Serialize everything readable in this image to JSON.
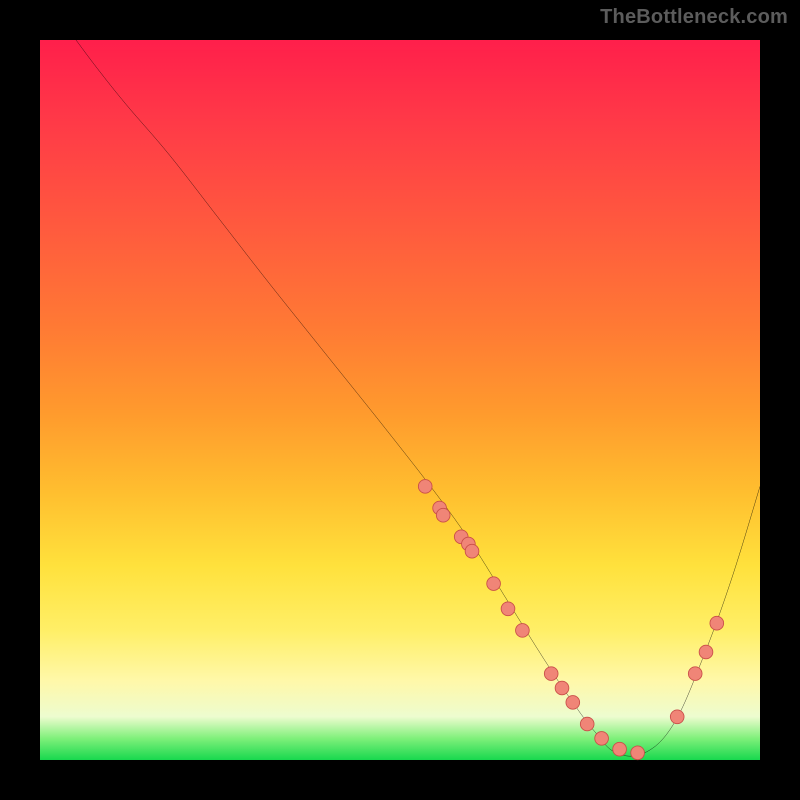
{
  "watermark": "TheBottleneck.com",
  "chart_data": {
    "type": "line",
    "title": "",
    "xlabel": "",
    "ylabel": "",
    "xlim": [
      0,
      100
    ],
    "ylim": [
      0,
      100
    ],
    "grid": false,
    "legend": false,
    "series": [
      {
        "name": "curve",
        "type": "line",
        "x": [
          5,
          8,
          12,
          18,
          25,
          32,
          40,
          48,
          55,
          60,
          65,
          70,
          74,
          77,
          80,
          84,
          88,
          92,
          96,
          100
        ],
        "y": [
          100,
          96,
          91,
          84,
          75,
          66,
          56,
          46,
          37,
          30,
          22,
          14,
          8,
          4,
          1,
          1,
          5,
          14,
          25,
          38
        ]
      },
      {
        "name": "markers",
        "type": "scatter",
        "x": [
          53.5,
          55.5,
          56.0,
          58.5,
          59.5,
          60.0,
          63.0,
          65.0,
          67.0,
          71.0,
          72.5,
          74.0,
          76.0,
          78.0,
          80.5,
          83.0,
          88.5,
          91.0,
          92.5,
          94.0
        ],
        "y": [
          38.0,
          35.0,
          34.0,
          31.0,
          30.0,
          29.0,
          24.5,
          21.0,
          18.0,
          12.0,
          10.0,
          8.0,
          5.0,
          3.0,
          1.5,
          1.0,
          6.0,
          12.0,
          15.0,
          19.0
        ]
      }
    ],
    "colors": {
      "curve": "#000000",
      "marker_fill": "#f08577",
      "marker_stroke": "#c94e48"
    }
  }
}
